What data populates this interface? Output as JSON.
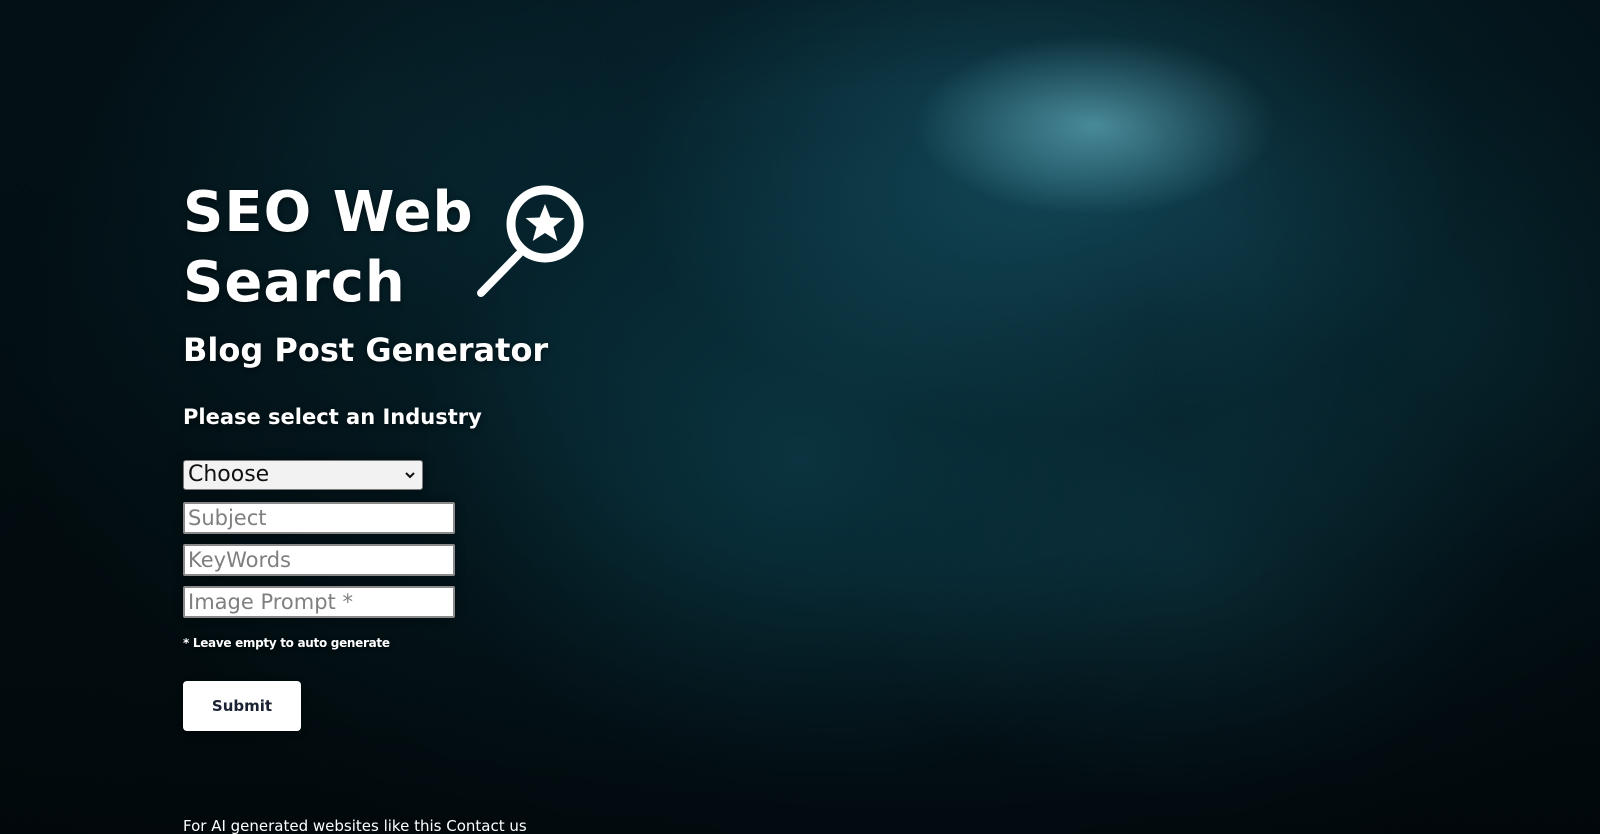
{
  "header": {
    "title_line1": "SEO Web",
    "title_line2": "Search",
    "logo_icon": "magnifier-star-icon"
  },
  "subtitle": "Blog Post Generator",
  "form": {
    "industry_label": "Please select an Industry",
    "industry_select": {
      "selected": "Choose"
    },
    "subject_placeholder": "Subject",
    "keywords_placeholder": "KeyWords",
    "image_prompt_placeholder": "Image Prompt *",
    "hint": "* Leave empty to auto generate",
    "submit_label": "Submit"
  },
  "footer": {
    "text": "For AI generated websites like this",
    "contact_label": "Contact us"
  },
  "colors": {
    "background_dark": "#03161c",
    "background_accent": "#1e6478",
    "text": "#ffffff",
    "button_bg": "#ffffff",
    "button_text": "#1a2233"
  }
}
